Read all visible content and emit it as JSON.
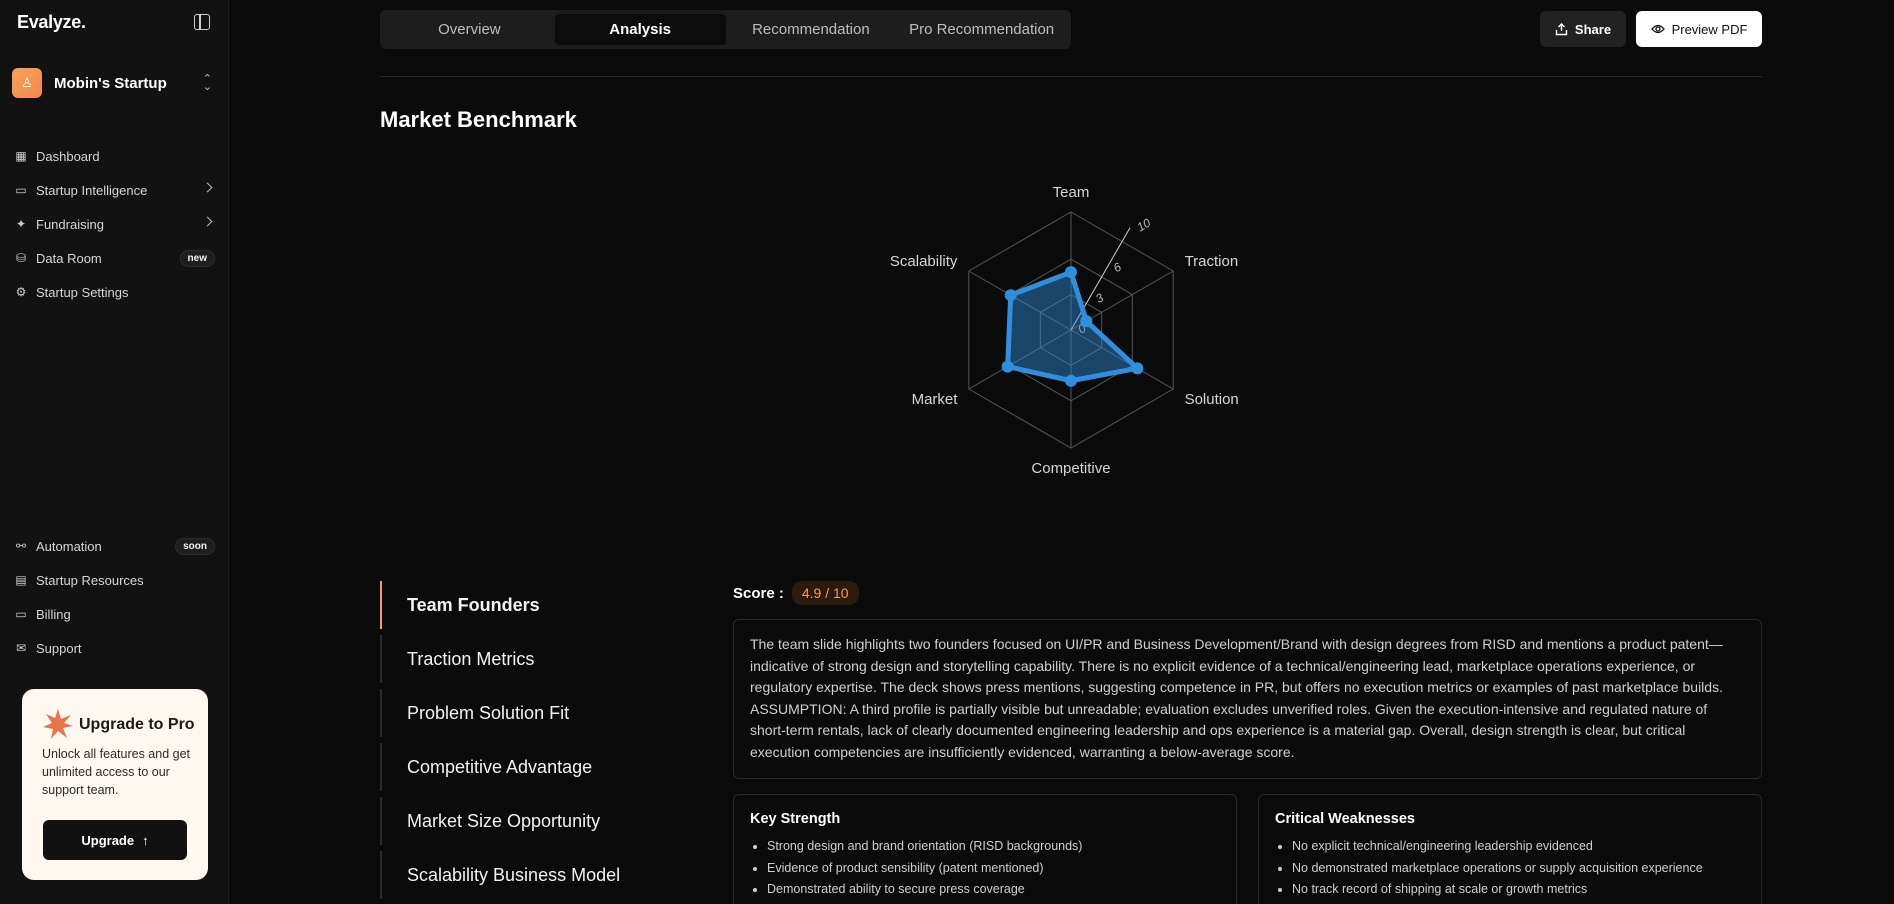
{
  "app": {
    "brand": "Evalyze."
  },
  "workspace": {
    "name": "Mobin's Startup"
  },
  "nav_top": [
    {
      "label": "Dashboard",
      "icon": "dashboard-icon"
    },
    {
      "label": "Startup Intelligence",
      "icon": "monitor-icon",
      "chevron": true
    },
    {
      "label": "Fundraising",
      "icon": "sparkle-icon",
      "chevron": true
    },
    {
      "label": "Data Room",
      "icon": "database-icon",
      "badge": "new"
    },
    {
      "label": "Startup Settings",
      "icon": "gear-icon"
    }
  ],
  "nav_bottom": [
    {
      "label": "Automation",
      "icon": "automation-icon",
      "badge": "soon"
    },
    {
      "label": "Startup Resources",
      "icon": "resources-icon"
    },
    {
      "label": "Billing",
      "icon": "card-icon"
    },
    {
      "label": "Support",
      "icon": "support-icon"
    }
  ],
  "upgrade": {
    "title": "Upgrade to Pro",
    "description": "Unlock all features and get unlimited access to our support team.",
    "button": "Upgrade"
  },
  "tabs": [
    {
      "label": "Overview",
      "active": false
    },
    {
      "label": "Analysis",
      "active": true
    },
    {
      "label": "Recommendation",
      "active": false
    },
    {
      "label": "Pro Recommendation",
      "active": false
    }
  ],
  "actions": {
    "share": "Share",
    "preview": "Preview PDF"
  },
  "section_title": "Market Benchmark",
  "chart_data": {
    "type": "radar",
    "axes": [
      "Team",
      "Traction",
      "Solution",
      "Competitive",
      "Market",
      "Scalability"
    ],
    "series": [
      {
        "values": [
          4.9,
          1.5,
          6.5,
          4.3,
          6.2,
          5.9
        ]
      }
    ],
    "range": [
      0,
      10
    ],
    "ticks": [
      "0",
      "3",
      "6",
      "10"
    ],
    "tick_values": [
      0,
      3,
      6,
      10
    ],
    "color": "#2f8fde"
  },
  "topics": [
    {
      "label": "Team Founders",
      "active": true
    },
    {
      "label": "Traction Metrics",
      "active": false
    },
    {
      "label": "Problem Solution Fit",
      "active": false
    },
    {
      "label": "Competitive Advantage",
      "active": false
    },
    {
      "label": "Market Size Opportunity",
      "active": false
    },
    {
      "label": "Scalability Business Model",
      "active": false
    }
  ],
  "score": {
    "label": "Score :",
    "value": "4.9 / 10"
  },
  "summary": "The team slide highlights two founders focused on UI/PR and Business Development/Brand with design degrees from RISD and mentions a product patent—indicative of strong design and storytelling capability. There is no explicit evidence of a technical/engineering lead, marketplace operations experience, or regulatory expertise. The deck shows press mentions, suggesting competence in PR, but offers no execution metrics or examples of past marketplace builds. ASSUMPTION: A third profile is partially visible but unreadable; evaluation excludes unverified roles. Given the execution-intensive and regulated nature of short-term rentals, lack of clearly documented engineering leadership and ops experience is a material gap. Overall, design strength is clear, but critical execution competencies are insufficiently evidenced, warranting a below-average score.",
  "strengths": {
    "title": "Key Strength",
    "items": [
      "Strong design and brand orientation (RISD backgrounds)",
      "Evidence of product sensibility (patent mentioned)",
      "Demonstrated ability to secure press coverage"
    ]
  },
  "weaknesses": {
    "title": "Critical Weaknesses",
    "items": [
      "No explicit technical/engineering leadership evidenced",
      "No demonstrated marketplace operations or supply acquisition experience",
      "No track record of shipping at scale or growth metrics"
    ]
  }
}
